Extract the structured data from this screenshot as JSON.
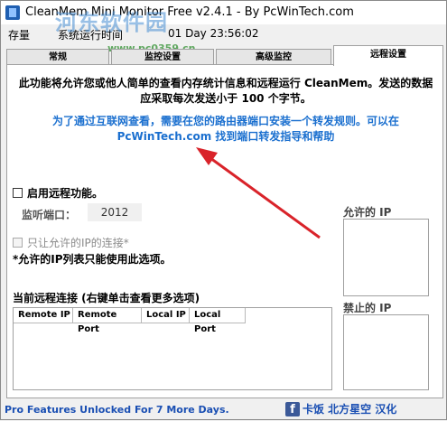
{
  "window": {
    "title": "CleanMem Mini Monitor Free v2.4.1 - By PcWinTech.com",
    "app_icon": "cleanmem-app-icon"
  },
  "status": {
    "left": "存量",
    "label": "系统运行时间",
    "uptime": "01 Day 23:56:02"
  },
  "watermark": {
    "text": "河东软件园",
    "url": "www.pc0359.cn"
  },
  "tabs": [
    {
      "label": "常规",
      "active": false
    },
    {
      "label": "监控设置",
      "active": false
    },
    {
      "label": "高级监控",
      "active": false
    },
    {
      "label": "远程设置",
      "active": true
    }
  ],
  "remote": {
    "description": "此功能将允许您或他人简单的查看内存统计信息和远程运行 CleanMem。发送的数据应采取每次发送小于 100 个字节。",
    "help_text": "为了通过互联网查看，需要在您的路由器端口安装一个转发规则。可以在 PcWinTech.com 找到端口转发指导和帮助",
    "enable_label": "启用远程功能。",
    "enable_checked": false,
    "port_label": "监听端口：",
    "port_value": "2012",
    "allowed_only_label": "只让允许的IP的连接*",
    "allowed_only_checked": false,
    "note": "*允许的IP列表只能使用此选项。",
    "allowed_ip_label": "允许的 IP",
    "blocked_ip_label": "禁止的 IP",
    "connections_title": "当前远程连接 (右键单击查看更多选项)",
    "columns": [
      "Remote IP",
      "Remote Port",
      "Local IP",
      "Local Port"
    ],
    "rows": []
  },
  "footer": {
    "promo": "Pro Features Unlocked For 7 More Days.",
    "credit": "卡饭 北方星空 汉化",
    "social_icon": "facebook-icon"
  },
  "colors": {
    "accent_blue": "#1a6fcf",
    "arrow_red": "#d9232a",
    "footer_blue": "#1a4fb3"
  }
}
